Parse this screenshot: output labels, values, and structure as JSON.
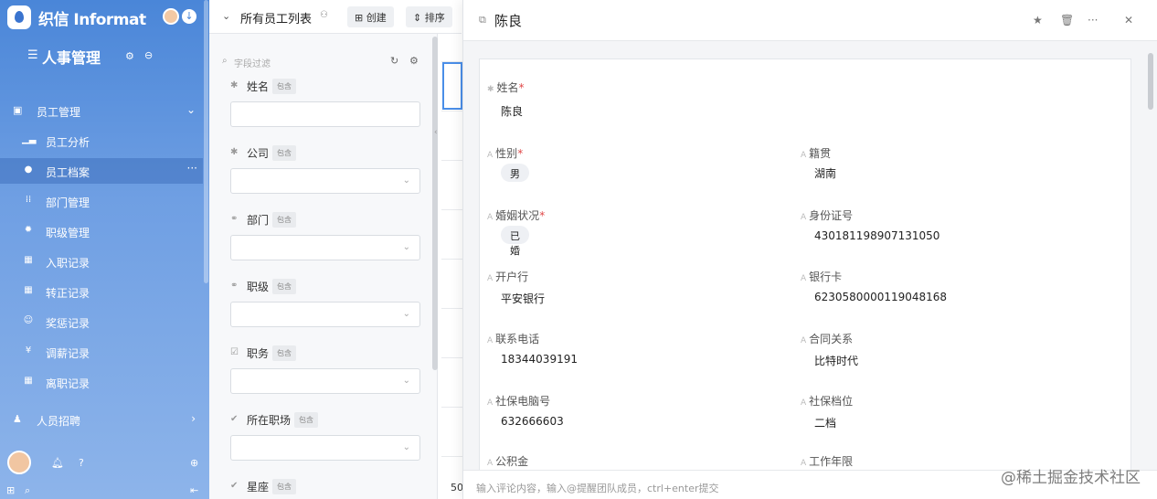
{
  "sidebar": {
    "brand": "织信 Informat",
    "app_title": "人事管理",
    "groups": [
      {
        "label": "员工管理",
        "icon": "person-card-icon"
      },
      {
        "label": "人员招聘",
        "icon": "person-pin-icon"
      }
    ],
    "items": [
      {
        "label": "员工分析",
        "icon": "chart-icon"
      },
      {
        "label": "员工档案",
        "icon": "user-circle-icon",
        "active": true
      },
      {
        "label": "部门管理",
        "icon": "org-icon"
      },
      {
        "label": "职级管理",
        "icon": "badge-icon"
      },
      {
        "label": "入职记录",
        "icon": "table-icon"
      },
      {
        "label": "转正记录",
        "icon": "table-icon"
      },
      {
        "label": "奖惩记录",
        "icon": "smile-icon"
      },
      {
        "label": "调薪记录",
        "icon": "yen-icon"
      },
      {
        "label": "离职记录",
        "icon": "table-icon"
      }
    ]
  },
  "toolbar": {
    "title": "所有员工列表",
    "create_label": "创建",
    "sort_label": "排序"
  },
  "filter": {
    "placeholder": "字段过滤",
    "badge": "包含",
    "fields": [
      {
        "name": "姓名",
        "icon": "asterisk-icon",
        "type": "text"
      },
      {
        "name": "公司",
        "icon": "asterisk-icon",
        "type": "select"
      },
      {
        "name": "部门",
        "icon": "link-icon",
        "type": "select"
      },
      {
        "name": "职级",
        "icon": "link-icon",
        "type": "select"
      },
      {
        "name": "职务",
        "icon": "checkbox-icon",
        "type": "select"
      },
      {
        "name": "所在职场",
        "icon": "check-circle-icon",
        "type": "select"
      },
      {
        "name": "星座",
        "icon": "check-circle-icon",
        "type": "select"
      }
    ]
  },
  "grid": {
    "page_size": "50"
  },
  "detail": {
    "title": "陈良",
    "fields": [
      {
        "label": "姓名",
        "required": true,
        "value": "陈良",
        "tag": false
      },
      {
        "label": "性别",
        "required": true,
        "value": "男",
        "tag": true
      },
      {
        "label": "籍贯",
        "required": false,
        "value": "湖南",
        "tag": false
      },
      {
        "label": "婚姻状况",
        "required": true,
        "value": "已婚",
        "tag": true
      },
      {
        "label": "身份证号",
        "required": false,
        "value": "430181198907131050",
        "tag": false
      },
      {
        "label": "开户行",
        "required": false,
        "value": "平安银行",
        "tag": false
      },
      {
        "label": "银行卡",
        "required": false,
        "value": "6230580000119048168",
        "tag": false
      },
      {
        "label": "联系电话",
        "required": false,
        "value": "18344039191",
        "tag": false
      },
      {
        "label": "合同关系",
        "required": false,
        "value": "比特时代",
        "tag": false
      },
      {
        "label": "社保电脑号",
        "required": false,
        "value": "632666603",
        "tag": false
      },
      {
        "label": "社保档位",
        "required": false,
        "value": "二档",
        "tag": false
      },
      {
        "label": "公积金",
        "required": false,
        "value": "",
        "tag": false
      },
      {
        "label": "工作年限",
        "required": false,
        "value": "",
        "tag": false
      }
    ],
    "comment_placeholder": "输入评论内容，输入@提醒团队成员，ctrl+enter提交"
  },
  "watermark": "@稀土掘金技术社区"
}
